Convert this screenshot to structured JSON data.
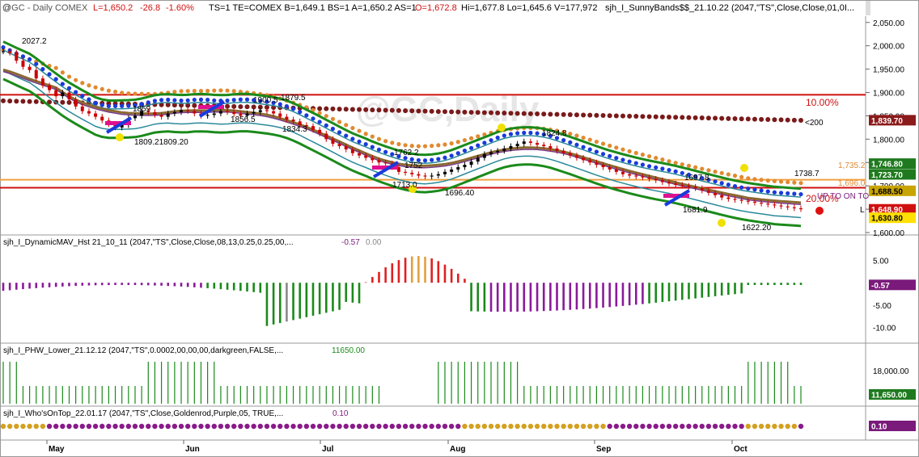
{
  "header": {
    "symbol": "@GC - Daily  COMEX",
    "last": "L=1,650.2",
    "change": "-26.8",
    "change_pct": "-1.60%",
    "fields": "TS=1  TE=COMEX  B=1,649.1  BS=1  A=1,650.2  AS=1",
    "open": "O=1,672.8",
    "hilo": "Hi=1,677.8  Lo=1,645.6  V=177,972",
    "study": "sjh_I_SunnyBands$$_21.10.22 (2047,\"TS\",Close,Close,01,0I..."
  },
  "watermark": "@GC,Daily",
  "panels": {
    "p2_title": "sjh_I_DynamicMAV_Hst 21_10_11 (2047,\"TS\",Close,Close,08,13,0.25,0.25,00,...",
    "p2_v1": "-0.57",
    "p2_v2": "0.00",
    "p3_title": "sjh_I_PHW_Lower_21.12.12 (2047,\"TS\",0.0002,00,00,00,darkgreen,FALSE,...",
    "p3_v1": "11650.00",
    "p4_title": "sjh_I_Who'sOnTop_22.01.17 (2047,\"TS\",Close,Goldenrod,Purple,05, TRUE,...",
    "p4_v1": "0.10"
  },
  "price_axis": {
    "ticks": [
      "2,050.00",
      "2,000.00",
      "1,950.00",
      "1,900.00",
      "1,850.00",
      "1,800.00",
      "1,750.00",
      "1,700.00",
      "1,650.00",
      "1,600.00"
    ],
    "labels": [
      {
        "text": "1,839.70",
        "bg": "#8b1a1a",
        "fg": "#ffffff"
      },
      {
        "text": "1,746.80",
        "bg": "#1f7a1f",
        "fg": "#ffffff"
      },
      {
        "text": "1,723.70",
        "bg": "#1f7a1f",
        "fg": "#ffffff"
      },
      {
        "text": "1,688.50",
        "bg": "#c8a400",
        "fg": "#000000"
      },
      {
        "text": "1,648.90",
        "bg": "#d01010",
        "fg": "#ffffff"
      },
      {
        "text": "1,630.80",
        "bg": "#ffe000",
        "fg": "#000000"
      }
    ]
  },
  "osc_axis": {
    "ticks": [
      "5.00",
      "-5.00",
      "-10.00"
    ],
    "label": {
      "text": "-0.57",
      "bg": "#7a1a7a",
      "fg": "#ffffff"
    }
  },
  "phw_axis": {
    "ticks": [
      "18,000.00"
    ],
    "label": {
      "text": "11,650.00",
      "bg": "#1f7a1f",
      "fg": "#ffffff"
    }
  },
  "who_axis": {
    "label": {
      "text": "0.10",
      "bg": "#7a1a7a",
      "fg": "#ffffff"
    }
  },
  "annotations": {
    "a2027": "2027.2",
    "a1859": "1859",
    "a1856": "1856.5",
    "a1834": "1834.3",
    "a1809": "1809.21809.20",
    "a1900": "1900.5",
    "a1879": "1879.5",
    "a1824": "1824.8",
    "a1762": "1762.2",
    "a1752": "1752",
    "a1713": "1713.0",
    "a1696": "1696.40",
    "a1697": "1697.8",
    "a1738": "1738.7",
    "a1681": "1681.9",
    "a1622": "1622.20",
    "pct10": "10.00%",
    "pct20": "20.00%",
    "lt200": "<200",
    "l1735": "1,735.2",
    "l1696": "1,696.0",
    "upto": "UP TO ON TO",
    "lmark": "L"
  },
  "x_labels": [
    "May",
    "Jun",
    "Jul",
    "Aug",
    "Sep",
    "Oct"
  ],
  "colors": {
    "price_up": "#000000",
    "price_down": "#cc0000",
    "green_band": "#1a8a1a",
    "teal_band": "#2a8a9a",
    "blue_dots": "#1a3adc",
    "orange_dots": "#e08a30",
    "maroon_dots": "#7a1a1a",
    "ma_brown": "#8a6a30",
    "ma_purple": "#7a3a8a",
    "hline_red": "#d01010",
    "hline_orange": "#f0a040",
    "osc_red": "#e02020",
    "osc_gold": "#e0a040",
    "osc_purple": "#8a1a9a",
    "osc_green": "#1a8a1a",
    "osc_gray": "#888888",
    "phw_green": "#1a8a1a",
    "who_gold": "#d4a020",
    "who_purple": "#8a1a8a"
  },
  "chart_data": {
    "type": "candlestick",
    "title": "@GC - Daily  COMEX",
    "x_months": [
      "May",
      "Jun",
      "Jul",
      "Aug",
      "Sep",
      "Oct"
    ],
    "ylim": [
      1600,
      2060
    ],
    "close": [
      1988,
      1985,
      1968,
      1955,
      1948,
      1930,
      1915,
      1905,
      1892,
      1900,
      1885,
      1870,
      1860,
      1855,
      1848,
      1840,
      1832,
      1825,
      1830,
      1845,
      1850,
      1860,
      1858,
      1852,
      1848,
      1855,
      1858,
      1862,
      1860,
      1855,
      1850,
      1852,
      1855,
      1860,
      1858,
      1854,
      1850,
      1855,
      1858,
      1862,
      1860,
      1855,
      1848,
      1842,
      1838,
      1830,
      1828,
      1820,
      1812,
      1800,
      1790,
      1785,
      1778,
      1770,
      1765,
      1760,
      1755,
      1750,
      1748,
      1740,
      1730,
      1728,
      1725,
      1722,
      1720,
      1722,
      1725,
      1730,
      1735,
      1740,
      1745,
      1752,
      1760,
      1768,
      1772,
      1775,
      1780,
      1785,
      1790,
      1795,
      1792,
      1788,
      1785,
      1780,
      1775,
      1770,
      1765,
      1760,
      1755,
      1750,
      1745,
      1740,
      1735,
      1730,
      1725,
      1722,
      1720,
      1718,
      1715,
      1712,
      1708,
      1705,
      1702,
      1700,
      1698,
      1695,
      1690,
      1685,
      1680,
      1675,
      1672,
      1670,
      1668,
      1666,
      1664,
      1662,
      1660,
      1658,
      1656,
      1654,
      1652,
      1650
    ],
    "hlines": {
      "red_upper": 1895,
      "orange": 1713,
      "red_lower": 1696
    },
    "oscillator": {
      "name": "sjh_I_DynamicMAV_Hst",
      "last": -0.57,
      "ylim": [
        -13,
        8
      ]
    },
    "phw": {
      "name": "sjh_I_PHW_Lower",
      "last": 11650
    },
    "whos_on_top": {
      "name": "sjh_I_Who'sOnTop",
      "last": 0.1
    }
  }
}
